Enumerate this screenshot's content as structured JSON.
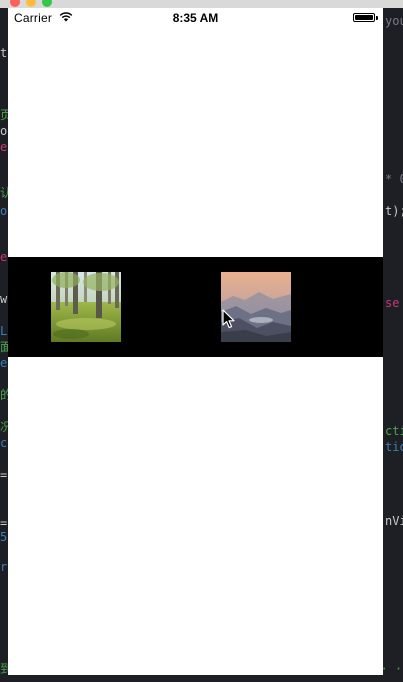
{
  "status_bar": {
    "carrier": "Carrier",
    "time": "8:35 AM",
    "battery_level": 1.0
  },
  "banner": {
    "background": "#000000",
    "images": [
      {
        "name": "forest-photo"
      },
      {
        "name": "mountain-sunset-photo"
      }
    ]
  },
  "cursor": {
    "icon": "arrow-pointer-icon"
  }
}
